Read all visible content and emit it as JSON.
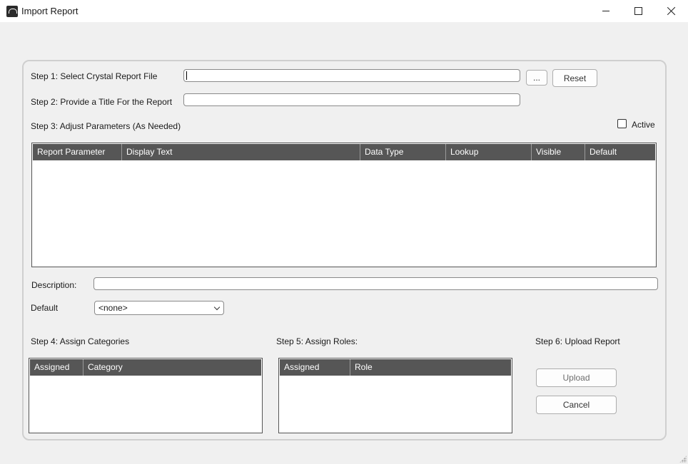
{
  "window": {
    "title": "Import Report",
    "controls": [
      "minimize",
      "maximize",
      "close"
    ]
  },
  "step1": {
    "label": "Step 1:  Select Crystal Report File",
    "value": "",
    "browse_label": "...",
    "reset_label": "Reset"
  },
  "step2": {
    "label": "Step 2:  Provide a Title For the Report",
    "value": ""
  },
  "step3": {
    "label": "Step 3:  Adjust Parameters (As Needed)",
    "active_label": "Active",
    "active_checked": false,
    "columns": [
      "Report Parameter",
      "Display Text",
      "Data Type",
      "Lookup",
      "Visible",
      "Default"
    ],
    "rows": []
  },
  "description": {
    "label": "Description:",
    "value": ""
  },
  "default": {
    "label": "Default",
    "selected": "<none>"
  },
  "step4": {
    "label": "Step 4:  Assign Categories",
    "columns": [
      "Assigned",
      "Category"
    ],
    "rows": []
  },
  "step5": {
    "label": "Step 5:  Assign Roles:",
    "columns": [
      "Assigned",
      "Role"
    ],
    "rows": []
  },
  "step6": {
    "label": "Step 6:  Upload Report",
    "upload_label": "Upload",
    "cancel_label": "Cancel"
  },
  "colors": {
    "grid_header": "#565656",
    "background": "#f0f0f0"
  }
}
